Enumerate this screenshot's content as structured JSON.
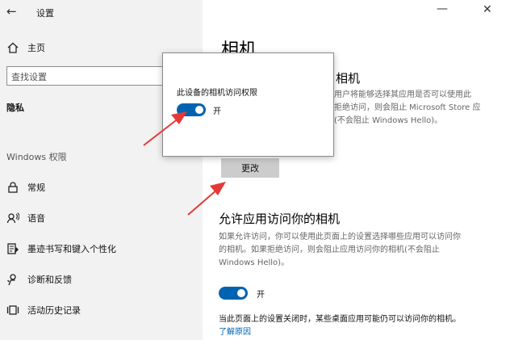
{
  "window": {
    "back_glyph": "←",
    "title": "设置",
    "minimize_glyph": "—",
    "close_glyph": "✕"
  },
  "sidebar": {
    "home": "主页",
    "search_placeholder": "查找设置",
    "current_section": "隐私",
    "group_label": "Windows 权限",
    "items": [
      {
        "label": "常规",
        "icon": "lock-icon"
      },
      {
        "label": "语音",
        "icon": "speech-icon"
      },
      {
        "label": "墨迹书写和键入个性化",
        "icon": "pen-document-icon"
      },
      {
        "label": "诊断和反馈",
        "icon": "feedback-icon"
      },
      {
        "label": "活动历史记录",
        "icon": "activity-history-icon"
      }
    ]
  },
  "main": {
    "title": "相机",
    "partial_heading": "相机",
    "desc_lines": [
      "用户将能够选择其应用是否可以使用此",
      "拒绝访问，则会阻止 Microsoft Store 应",
      "(不会阻止 Windows Hello)。"
    ],
    "change_button": "更改",
    "allow_heading": "允许应用访问你的相机",
    "allow_desc": [
      "如果允许访问，你可以使用此页面上的设置选择哪些应用可以访问你",
      "的相机。如果拒绝访问，则会阻止应用访问你的相机(不会阻止",
      "Windows Hello)。"
    ],
    "allow_toggle_label": "开",
    "note": "当此页面上的设置关闭时，某些桌面应用可能仍可以访问你的相机。",
    "learn_link": "了解原因"
  },
  "dialog": {
    "title": "此设备的相机访问权限",
    "toggle_label": "开"
  },
  "colors": {
    "accent": "#0063b1",
    "annotation_arrow": "#e53935",
    "sidebar_bg": "#f2f2f2"
  }
}
